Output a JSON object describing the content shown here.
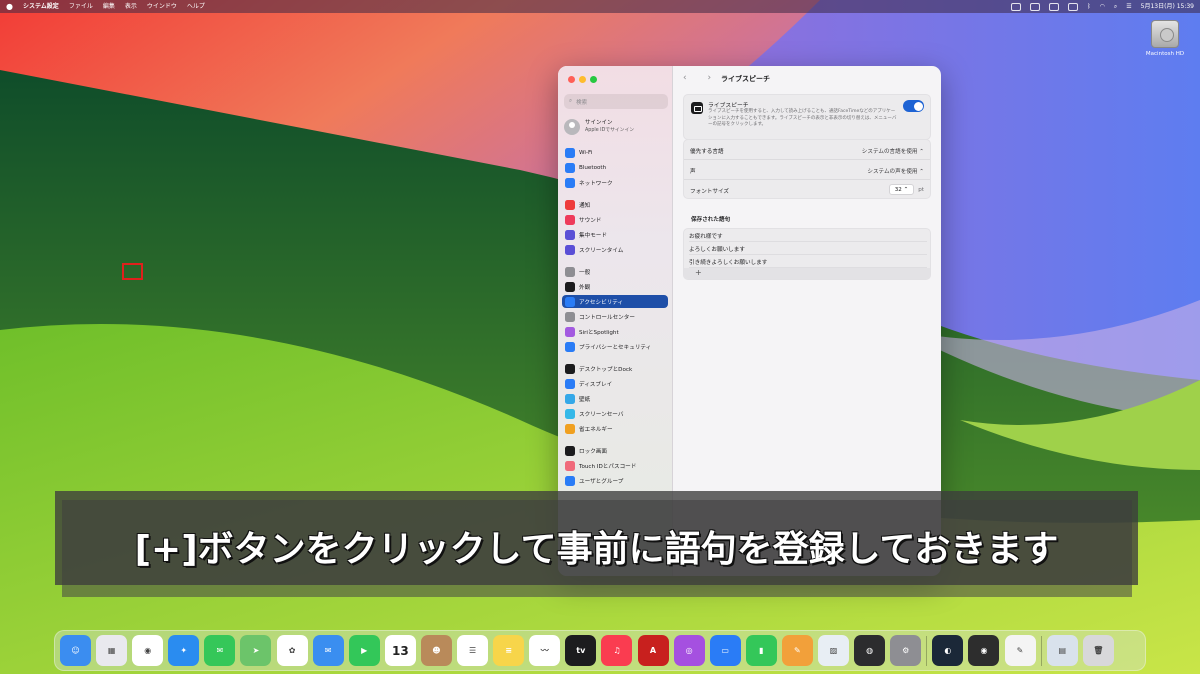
{
  "menubar": {
    "apple": "",
    "app_name": "システム設定",
    "menus": [
      "ファイル",
      "編集",
      "表示",
      "ウインドウ",
      "ヘルプ"
    ],
    "clock": "5月13日(月) 15:39"
  },
  "desktop": {
    "drive_label": "Macintosh HD"
  },
  "window": {
    "search_placeholder": "検索",
    "account": {
      "title": "サインイン",
      "subtitle": "Apple IDでサインイン"
    },
    "sidebar": [
      {
        "label": "Wi-Fi",
        "color": "#2a7cf6"
      },
      {
        "label": "Bluetooth",
        "color": "#2a7cf6"
      },
      {
        "label": "ネットワーク",
        "color": "#2a7cf6"
      },
      {
        "label": "通知",
        "color": "#ee3b3b"
      },
      {
        "label": "サウンド",
        "color": "#ee3b5b"
      },
      {
        "label": "集中モード",
        "color": "#5a4fd6"
      },
      {
        "label": "スクリーンタイム",
        "color": "#5a4fd6"
      },
      {
        "label": "一般",
        "color": "#8e8e93"
      },
      {
        "label": "外観",
        "color": "#1c1c1e"
      },
      {
        "label": "アクセシビリティ",
        "color": "#2a7cf6",
        "selected": true
      },
      {
        "label": "コントロールセンター",
        "color": "#8e8e93"
      },
      {
        "label": "SiriとSpotlight",
        "color": "#a35ae0"
      },
      {
        "label": "プライバシーとセキュリティ",
        "color": "#2a7cf6"
      },
      {
        "label": "デスクトップとDock",
        "color": "#1c1c1e"
      },
      {
        "label": "ディスプレイ",
        "color": "#2a7cf6"
      },
      {
        "label": "壁紙",
        "color": "#35a8e8"
      },
      {
        "label": "スクリーンセーバ",
        "color": "#35b8e8"
      },
      {
        "label": "省エネルギー",
        "color": "#f0a020"
      },
      {
        "label": "ロック画面",
        "color": "#1c1c1e"
      },
      {
        "label": "Touch IDとパスコード",
        "color": "#f06a7a"
      },
      {
        "label": "ユーザとグループ",
        "color": "#2a7cf6"
      }
    ],
    "page_title": "ライブスピーチ",
    "nav": "‹ ›",
    "live_speech": {
      "title": "ライブスピーチ",
      "description": "ライブスピーチを使用すると、入力して読み上げることも、通話FaceTimeなどのアプリケーションに入力することもできます。ライブスピーチの表示と非表示の切り替えは、メニューバーの記号をクリックします。",
      "enabled": true
    },
    "settings": {
      "language_label": "優先する言語",
      "language_value": "システムの言語を使用 ⌃",
      "voice_label": "声",
      "voice_value": "システムの声を使用 ⌃",
      "font_label": "フォントサイズ",
      "font_value": "32 ⌃",
      "font_unit": "pt"
    },
    "saved_heading": "保存された語句",
    "phrases": [
      "お疲れ様です",
      "よろしくお願いします",
      "引き続きよろしくお願いします"
    ],
    "add_button": "+",
    "help": "?"
  },
  "caption": "[+]ボタンをクリックして事前に語句を登録しておきます",
  "dock": [
    {
      "name": "finder",
      "color": "#3b8df0",
      "glyph": "☺"
    },
    {
      "name": "launchpad",
      "color": "#e9e9ee",
      "glyph": "▦"
    },
    {
      "name": "chrome",
      "color": "#ffffff",
      "glyph": "◉"
    },
    {
      "name": "safari",
      "color": "#2a8cf0",
      "glyph": "✦"
    },
    {
      "name": "messages",
      "color": "#35c759",
      "glyph": "✉"
    },
    {
      "name": "maps",
      "color": "#6cc46a",
      "glyph": "➤"
    },
    {
      "name": "photos",
      "color": "#ffffff",
      "glyph": "✿"
    },
    {
      "name": "mail",
      "color": "#3a8ef0",
      "glyph": "✉"
    },
    {
      "name": "facetime",
      "color": "#33c759",
      "glyph": "▶"
    },
    {
      "name": "calendar",
      "color": "#ffffff",
      "glyph": "13"
    },
    {
      "name": "contacts",
      "color": "#b98a5a",
      "glyph": "☻"
    },
    {
      "name": "reminders",
      "color": "#ffffff",
      "glyph": "☰"
    },
    {
      "name": "notes",
      "color": "#f7d54a",
      "glyph": "≡"
    },
    {
      "name": "freeform",
      "color": "#ffffff",
      "glyph": "〰"
    },
    {
      "name": "apple-tv",
      "color": "#1c1c1e",
      "glyph": "tv"
    },
    {
      "name": "music",
      "color": "#fa3c50",
      "glyph": "♫"
    },
    {
      "name": "acrobat",
      "color": "#c8201e",
      "glyph": "A"
    },
    {
      "name": "podcasts",
      "color": "#a550e0",
      "glyph": "◎"
    },
    {
      "name": "keynote",
      "color": "#2a7cf6",
      "glyph": "▭"
    },
    {
      "name": "numbers",
      "color": "#34c759",
      "glyph": "▮"
    },
    {
      "name": "pages",
      "color": "#f2a03a",
      "glyph": "✎"
    },
    {
      "name": "preview",
      "color": "#e8eef4",
      "glyph": "▨"
    },
    {
      "name": "screenshot-utility",
      "color": "#2c2c2e",
      "glyph": "◍"
    },
    {
      "name": "system-settings",
      "color": "#8e8e93",
      "glyph": "⚙"
    },
    {
      "name": "steam",
      "color": "#1b2838",
      "glyph": "◐"
    },
    {
      "name": "obs",
      "color": "#2d2d2d",
      "glyph": "◉"
    },
    {
      "name": "textedit",
      "color": "#f4f4f4",
      "glyph": "✎"
    },
    {
      "name": "downloads-stack",
      "color": "#d9e2ec",
      "glyph": "▤"
    },
    {
      "name": "trash",
      "color": "#d8d8da",
      "glyph": "🗑"
    }
  ]
}
